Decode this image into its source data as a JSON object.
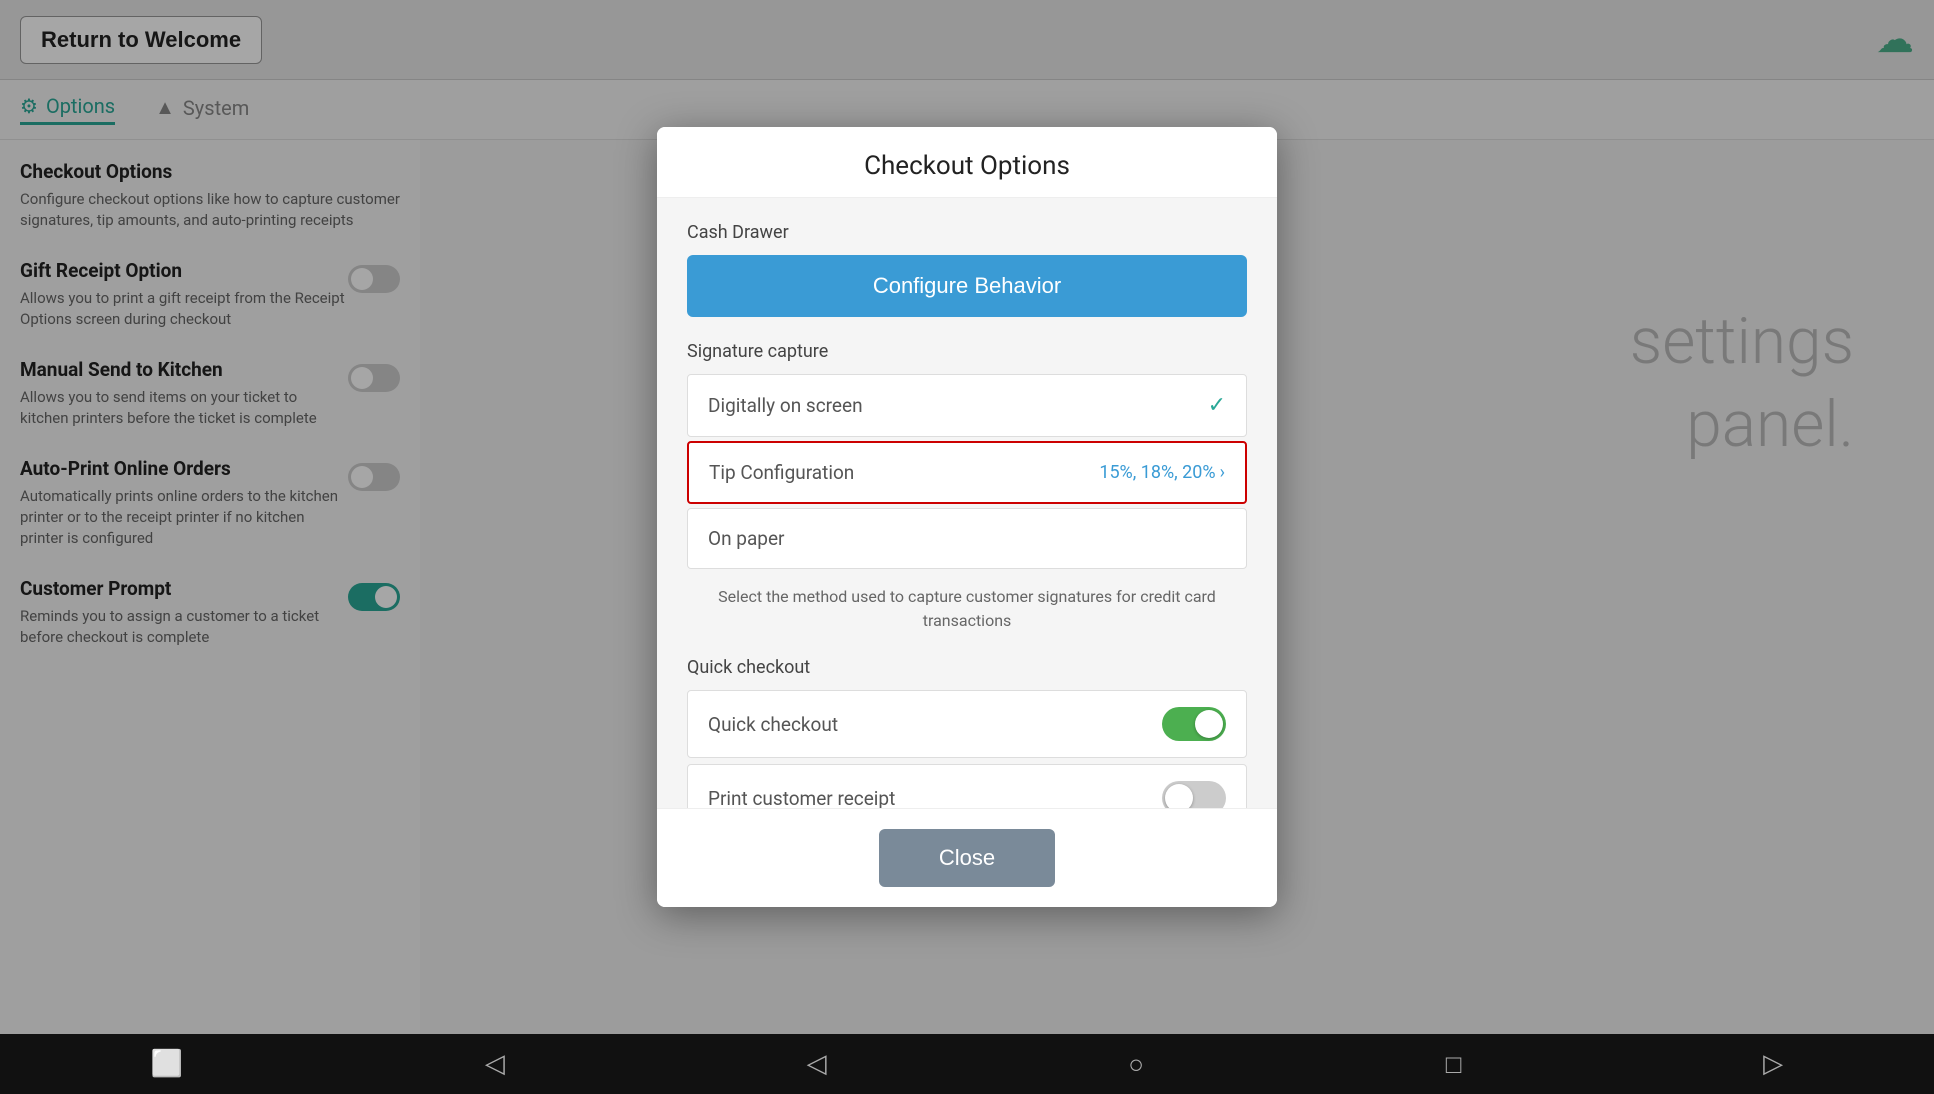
{
  "topBar": {
    "returnLabel": "Return to Welcome",
    "cloudIcon": "☁"
  },
  "tabs": [
    {
      "id": "options",
      "label": "Options",
      "active": true,
      "icon": "⚙"
    },
    {
      "id": "system",
      "label": "System",
      "active": false,
      "icon": "▲"
    }
  ],
  "sidebar": {
    "items": [
      {
        "title": "Checkout Options",
        "desc": "Configure checkout options like how to capture customer signatures, tip amounts, and auto-printing receipts",
        "hasToggle": false
      },
      {
        "title": "Gift Receipt Option",
        "desc": "Allows you to print a gift receipt from the Receipt Options screen during checkout",
        "hasToggle": true,
        "toggleOn": false
      },
      {
        "title": "Manual Send to Kitchen",
        "desc": "Allows you to send items on your ticket to kitchen printers before the ticket is complete",
        "hasToggle": true,
        "toggleOn": false
      },
      {
        "title": "Auto-Print Online Orders",
        "desc": "Automatically prints online orders to the kitchen printer or to the receipt printer if no kitchen printer is configured",
        "hasToggle": true,
        "toggleOn": false
      },
      {
        "title": "Customer Prompt",
        "desc": "Reminds you to assign a customer to a ticket before checkout is complete",
        "hasToggle": true,
        "toggleOn": true
      }
    ]
  },
  "bgWatermark": {
    "line1": "settings",
    "line2": "panel."
  },
  "modal": {
    "title": "Checkout Options",
    "cashDrawer": {
      "label": "Cash Drawer",
      "configureBtn": "Configure Behavior"
    },
    "signatureCapture": {
      "label": "Signature capture",
      "options": [
        {
          "text": "Digitally on screen",
          "selected": true
        },
        {
          "text": "On paper",
          "selected": false
        }
      ],
      "description": "Select the method used to capture customer signatures for credit card transactions"
    },
    "tipConfig": {
      "label": "Tip Configuration",
      "value": "15%, 18%, 20%",
      "highlighted": true
    },
    "quickCheckout": {
      "label": "Quick checkout",
      "items": [
        {
          "label": "Quick checkout",
          "on": true
        },
        {
          "label": "Print customer receipt",
          "on": false
        }
      ]
    },
    "closeBtn": "Close"
  },
  "bottomNav": {
    "icons": [
      "📷",
      "🔊",
      "◁",
      "○",
      "□",
      "🔊"
    ]
  }
}
